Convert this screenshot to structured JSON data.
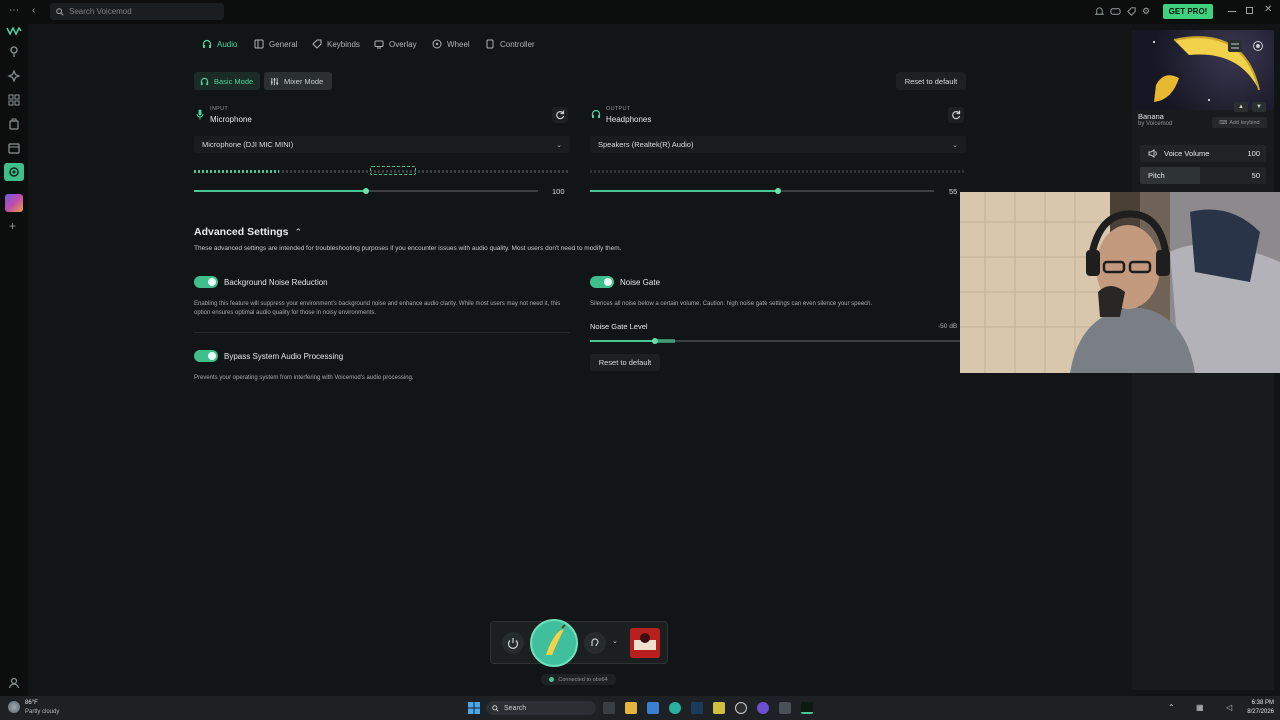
{
  "titlebar": {
    "search_placeholder": "Search Voicemod",
    "get_pro": "GET PRO!"
  },
  "tabs": [
    {
      "label": "Audio",
      "icon": "headphones-icon",
      "active": true
    },
    {
      "label": "General",
      "icon": "app-icon"
    },
    {
      "label": "Keybinds",
      "icon": "tag-icon"
    },
    {
      "label": "Overlay",
      "icon": "monitor-icon"
    },
    {
      "label": "Wheel",
      "icon": "wheel-icon"
    },
    {
      "label": "Controller",
      "icon": "phone-icon"
    }
  ],
  "modes": {
    "basic": "Basic Mode",
    "mixer": "Mixer Mode",
    "reset": "Reset to default"
  },
  "input": {
    "small": "INPUT",
    "label": "Microphone",
    "device": "Microphone (DJI MIC MINI)",
    "volume": "100",
    "volume_fraction": 0.5
  },
  "output": {
    "small": "OUTPUT",
    "label": "Headphones",
    "device": "Speakers (Realtek(R) Audio)",
    "volume": "55",
    "volume_fraction": 0.55
  },
  "advanced": {
    "title": "Advanced Settings",
    "desc": "These advanced settings are intended for troubleshooting purposes if you encounter issues with audio quality. Most users don't need to modify them.",
    "bg_noise": {
      "label": "Background Noise Reduction",
      "desc": "Enabling this feature will suppress your environment's background noise and enhance audio clarity. While most users may not need it, this option ensures optimal audio quality for those in noisy environments."
    },
    "bypass": {
      "label": "Bypass System Audio Processing",
      "desc": "Prevents your operating system from interfering with Voicemod's audio processing."
    },
    "noise_gate": {
      "label": "Noise Gate",
      "desc": "Silences all noise below a certain volume. Caution: high noise gate settings can even silence your speech.",
      "level_label": "Noise Gate Level",
      "level_value": "-50 dB",
      "level_fraction": 0.17,
      "reset": "Reset to default"
    }
  },
  "voice_panel": {
    "name": "Banana",
    "by": "by Voicemod",
    "add_keybind": "Add keybind",
    "voice_volume_label": "Voice Volume",
    "voice_volume": "100",
    "pitch_label": "Pitch",
    "pitch": "50"
  },
  "dock": {
    "connected": "Connected to obs64"
  },
  "taskbar": {
    "weather_temp": "86°F",
    "weather_desc": "Partly cloudy",
    "search": "Search",
    "time": "6:38 PM",
    "date": "8/27/2026"
  },
  "colors": {
    "accent": "#48c695",
    "get_pro": "#3fd080",
    "background": "#121515"
  }
}
